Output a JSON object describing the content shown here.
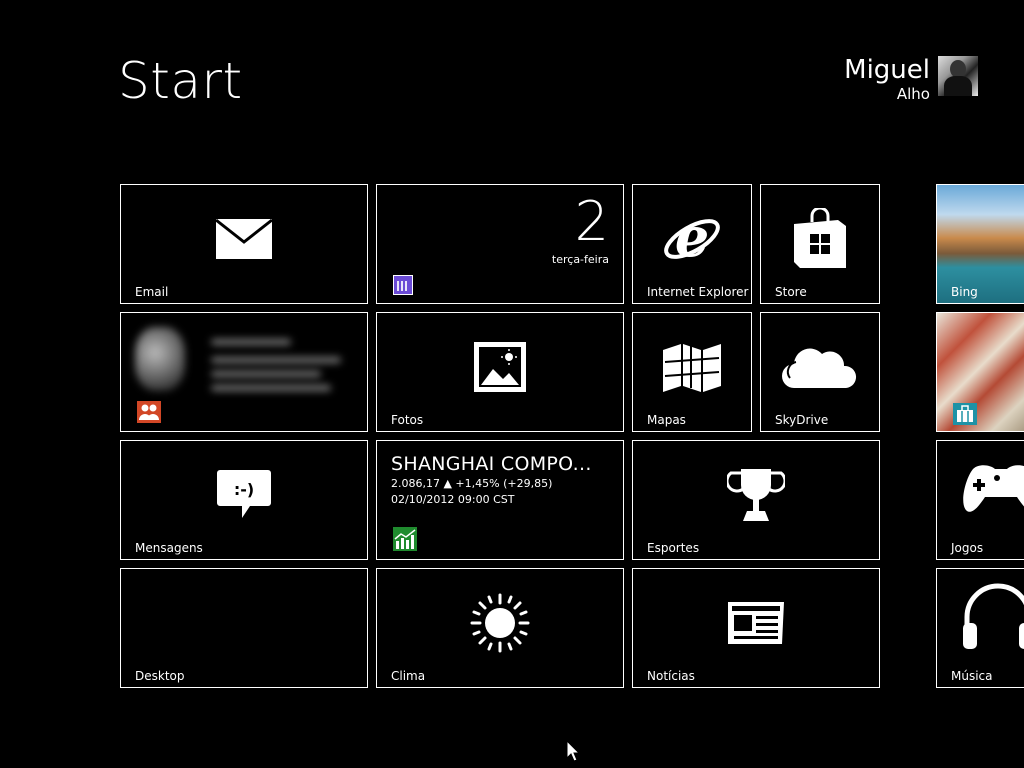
{
  "header": {
    "title": "Start",
    "user": {
      "first_name": "Miguel",
      "last_name": "Alho"
    }
  },
  "tiles": {
    "email": {
      "label": "Email"
    },
    "calendar": {
      "day_number": "2",
      "weekday": "terça-feira"
    },
    "ie": {
      "label": "Internet Explorer"
    },
    "store": {
      "label": "Store"
    },
    "bing": {
      "label": "Bing"
    },
    "fotos": {
      "label": "Fotos"
    },
    "mapas": {
      "label": "Mapas"
    },
    "skydrive": {
      "label": "SkyDrive"
    },
    "mensagens": {
      "label": "Mensagens",
      "emoticon": ":-)"
    },
    "finance": {
      "name": "SHANGHAI COMPO...",
      "quote": "2.086,17 ▲ +1,45% (+29,85)",
      "datetime": "02/10/2012 09:00 CST"
    },
    "esportes": {
      "label": "Esportes"
    },
    "jogos": {
      "label": "Jogos"
    },
    "desktop": {
      "label": "Desktop"
    },
    "clima": {
      "label": "Clima"
    },
    "noticias": {
      "label": "Notícias"
    },
    "musica": {
      "label": "Música"
    }
  },
  "colors": {
    "background": "#000000",
    "calendar_accent": "#6b4bd6",
    "people_accent": "#d24726",
    "finance_accent": "#1f8b2e",
    "travel_accent": "#1e92a6"
  }
}
